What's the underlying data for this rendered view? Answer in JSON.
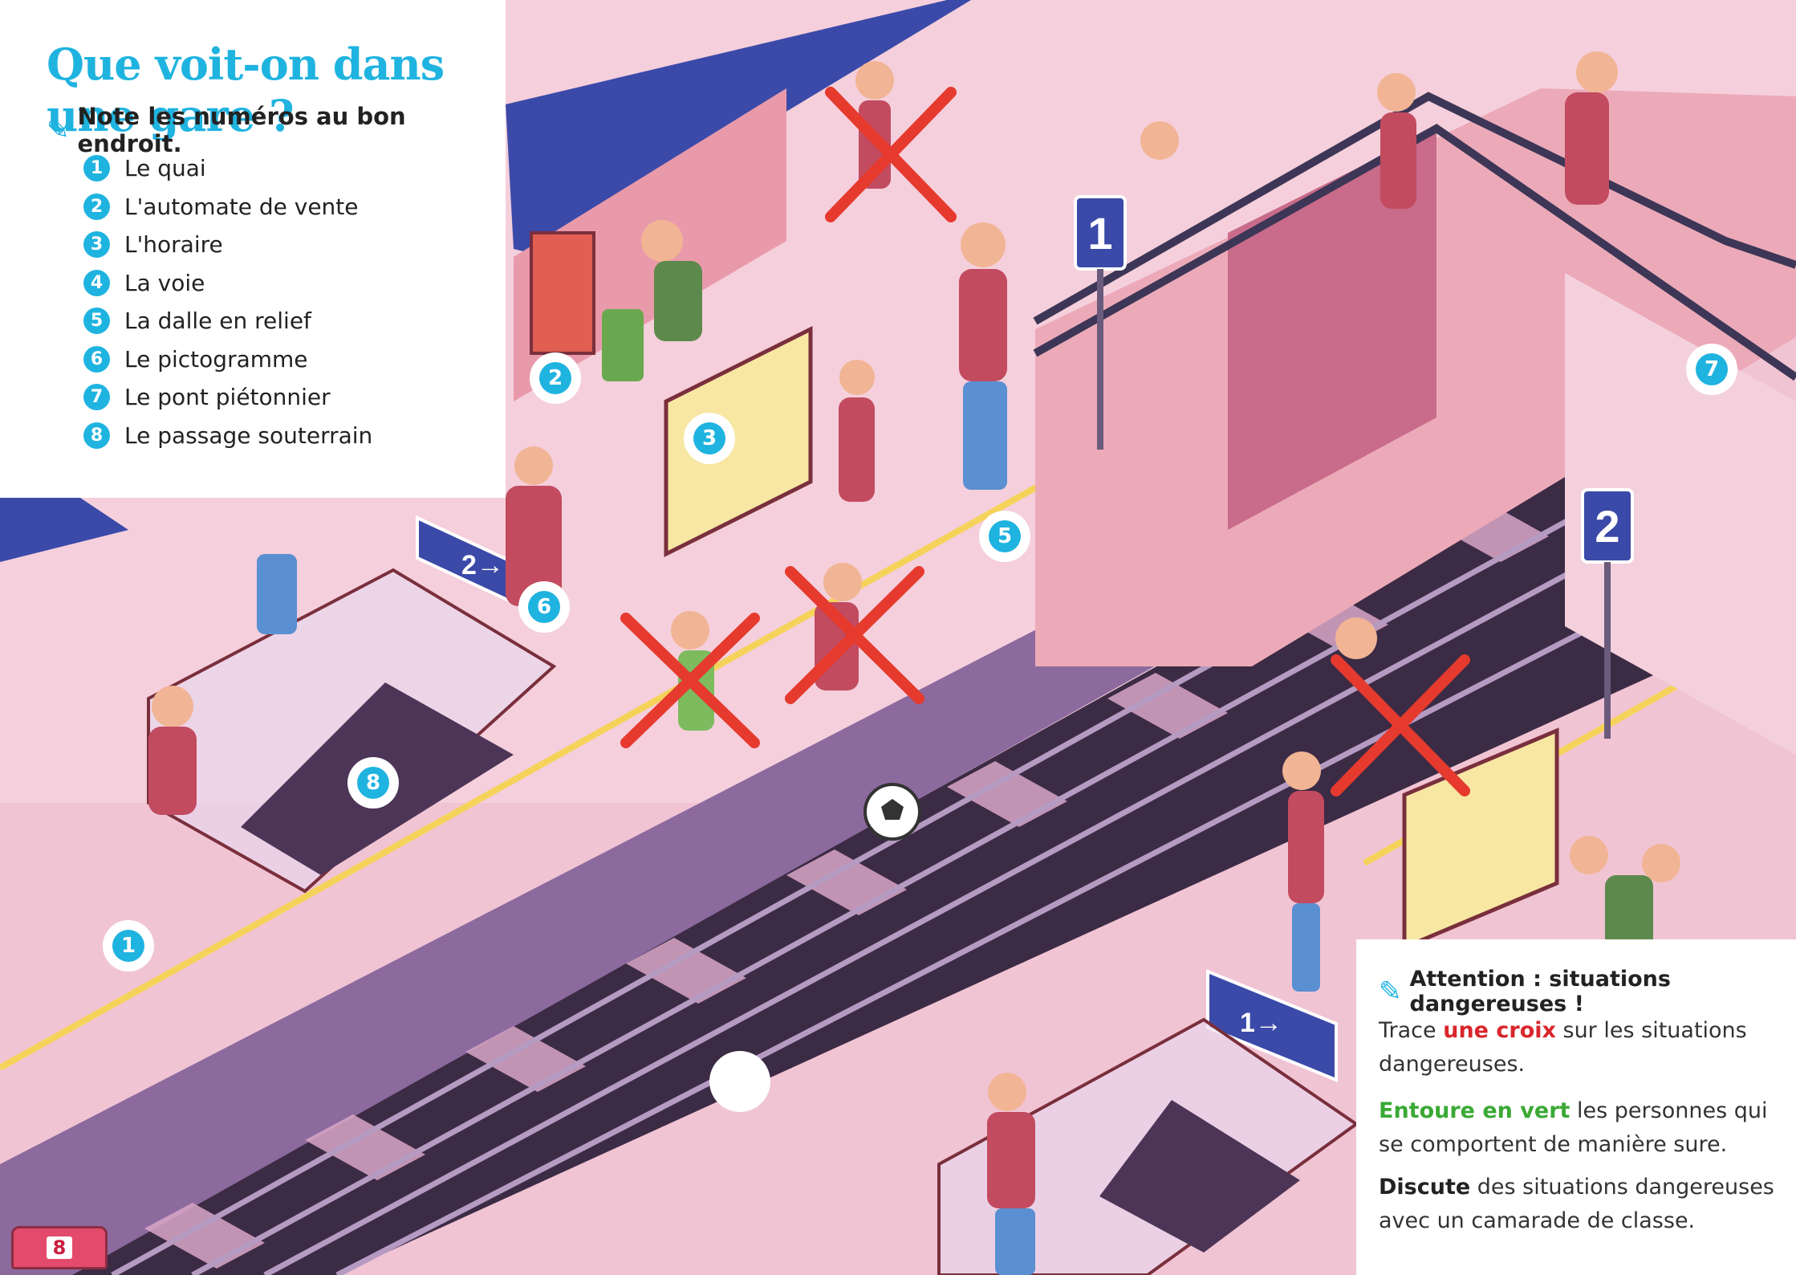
{
  "title": "Que voit-on dans une gare ?",
  "instruction": "Note les numéros au bon endroit.",
  "legend": [
    {
      "number": "1",
      "label": "Le quai"
    },
    {
      "number": "2",
      "label": "L'automate de vente"
    },
    {
      "number": "3",
      "label": "L'horaire"
    },
    {
      "number": "4",
      "label": "La voie"
    },
    {
      "number": "5",
      "label": "La dalle en relief"
    },
    {
      "number": "6",
      "label": "Le pictogramme"
    },
    {
      "number": "7",
      "label": "Le pont piétonnier"
    },
    {
      "number": "8",
      "label": "Le passage souterrain"
    }
  ],
  "markers": [
    "2",
    "3",
    "5",
    "6",
    "7",
    "8",
    "1",
    ""
  ],
  "signs": {
    "platform_1": "1",
    "platform_2": "2",
    "direction_left": "2→",
    "direction_right": "1→"
  },
  "danger": {
    "heading": "Attention : situations dangereuses !",
    "line1_prefix": "Trace ",
    "line1_emph": "une croix",
    "line1_suffix": " sur les situations",
    "line2": "dangereuses.",
    "line3_emph": "Entoure en vert",
    "line3_suffix": " les personnes qui",
    "line4": "se comportent de manière sure.",
    "line5_emph": "Discute",
    "line5_suffix": " des situations dangereuses",
    "line6": "avec un camarade de classe."
  },
  "page_number": "8",
  "colors": {
    "accent_blue": "#1fb3e0",
    "cross_red": "#e63a2e",
    "scene_pink": "#f3c9d7",
    "track_dark": "#3c2b44"
  }
}
